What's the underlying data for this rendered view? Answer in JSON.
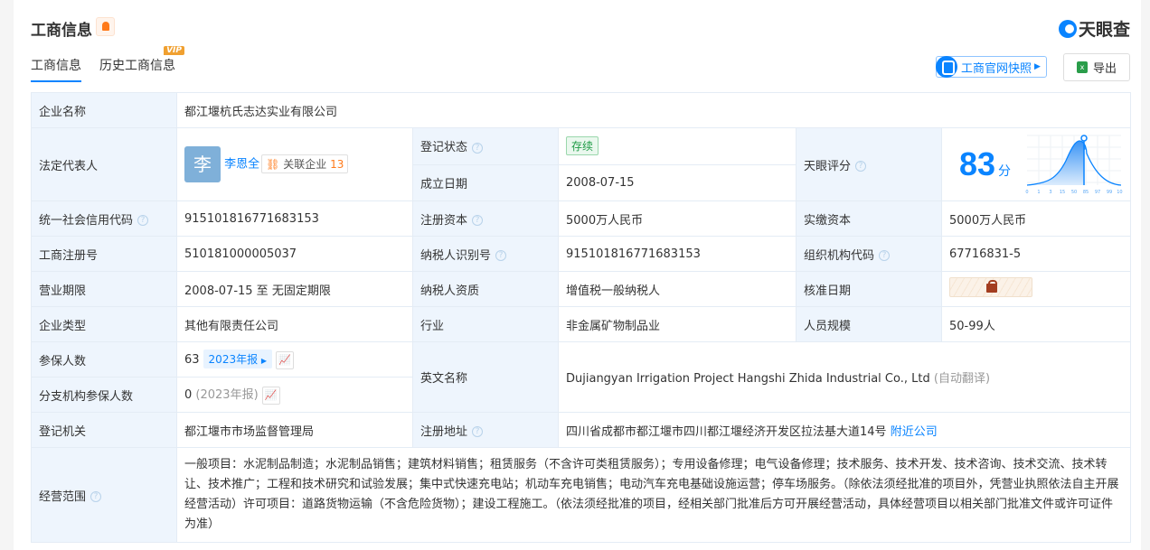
{
  "header": {
    "title": "工商信息",
    "logo": "天眼查",
    "snapshot_label": "工商官网快照",
    "export_label": "导出"
  },
  "tabs": [
    {
      "label": "工商信息"
    },
    {
      "label": "历史工商信息",
      "badge": "VIP"
    }
  ],
  "table": {
    "company_name_label": "企业名称",
    "company_name": "都江堰杭氏志达实业有限公司",
    "legal_rep_label": "法定代表人",
    "legal_rep_avatar": "李",
    "legal_rep_name": "李恩全",
    "related_label": "关联企业",
    "related_count": "13",
    "status_label": "登记状态",
    "status": "存续",
    "founded_label": "成立日期",
    "founded": "2008-07-15",
    "score_label": "天眼评分",
    "score": "83",
    "score_unit": "分",
    "credit_code_label": "统一社会信用代码",
    "credit_code": "915101816771683153",
    "reg_capital_label": "注册资本",
    "reg_capital": "5000万人民币",
    "paid_capital_label": "实缴资本",
    "paid_capital": "5000万人民币",
    "reg_no_label": "工商注册号",
    "reg_no": "510181000005037",
    "taxpayer_id_label": "纳税人识别号",
    "taxpayer_id": "915101816771683153",
    "org_code_label": "组织机构代码",
    "org_code": "67716831-5",
    "term_label": "营业期限",
    "term": "2008-07-15 至 无固定期限",
    "taxpayer_type_label": "纳税人资质",
    "taxpayer_type": "增值税一般纳税人",
    "approve_label": "核准日期",
    "type_label": "企业类型",
    "type": "其他有限责任公司",
    "industry_label": "行业",
    "industry": "非金属矿物制品业",
    "staff_label": "人员规模",
    "staff": "50-99人",
    "insured_label": "参保人数",
    "insured": "63",
    "insured_year": "2023年报",
    "branch_insured_label": "分支机构参保人数",
    "branch_insured": "0",
    "branch_insured_year": "(2023年报)",
    "en_name_label": "英文名称",
    "en_name": "Dujiangyan Irrigation Project Hangshi Zhida Industrial Co., Ltd",
    "en_name_note": "(自动翻译)",
    "authority_label": "登记机关",
    "authority": "都江堰市市场监督管理局",
    "address_label": "注册地址",
    "address": "四川省成都市都江堰市四川都江堰经济开发区拉法基大道14号",
    "nearby_label": "附近公司",
    "scope_label": "经营范围",
    "scope": "一般项目：水泥制品制造；水泥制品销售；建筑材料销售；租赁服务（不含许可类租赁服务）；专用设备修理；电气设备修理；技术服务、技术开发、技术咨询、技术交流、技术转让、技术推广；工程和技术研究和试验发展；集中式快速充电站；机动车充电销售；电动汽车充电基础设施运营；停车场服务。（除依法须经批准的项目外，凭营业执照依法自主开展经营活动）许可项目：道路货物运输（不含危险货物）；建设工程施工。（依法须经批准的项目，经相关部门批准后方可开展经营活动，具体经营项目以相关部门批准文件或许可证件为准）"
  },
  "chart_data": {
    "type": "area",
    "title": "天眼评分分布",
    "x_ticks": [
      "0",
      "1",
      "3",
      "15",
      "50",
      "85",
      "97",
      "99",
      "100"
    ],
    "marker": "85",
    "score": 83
  }
}
